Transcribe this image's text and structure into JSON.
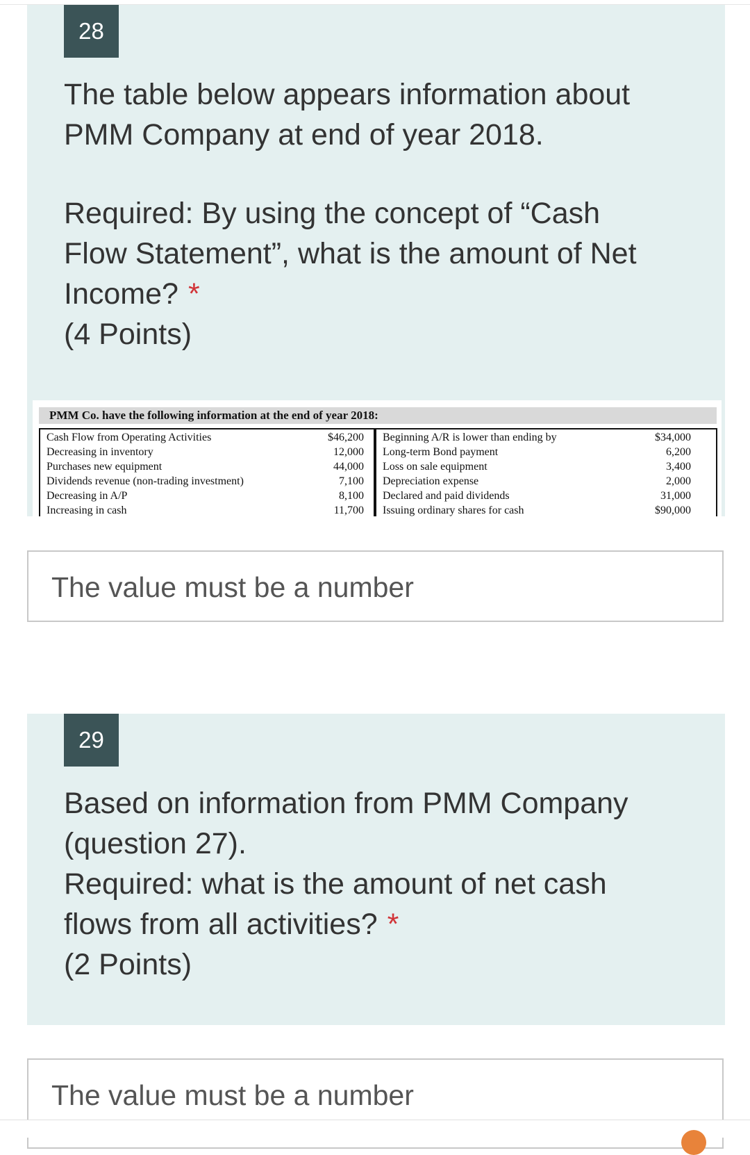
{
  "q28": {
    "number": "28",
    "title_lines": [
      "The table below appears information about",
      "PMM Company at end of year 2018.",
      "",
      "Required: By using the concept of “Cash",
      "Flow Statement”, what is the amount of Net",
      "Income?"
    ],
    "required_mark": "*",
    "points": "(4 Points)",
    "table": {
      "header": "PMM Co. have the following information at the end of year 2018:",
      "left": [
        {
          "label": "Cash Flow from Operating Activities",
          "value": "$46,200"
        },
        {
          "label": "Decreasing in inventory",
          "value": "12,000"
        },
        {
          "label": "Purchases new equipment",
          "value": "44,000"
        },
        {
          "label": "Dividends revenue (non-trading investment)",
          "value": "7,100"
        },
        {
          "label": "Decreasing in A/P",
          "value": "8,100"
        },
        {
          "label": "Increasing in cash",
          "value": "11,700"
        }
      ],
      "right": [
        {
          "label": "Beginning A/R is lower than ending by",
          "value": "$34,000"
        },
        {
          "label": "Long-term Bond payment",
          "value": "6,200"
        },
        {
          "label": "Loss on sale equipment",
          "value": "3,400"
        },
        {
          "label": "Depreciation expense",
          "value": "2,000"
        },
        {
          "label": "Declared and paid dividends",
          "value": "31,000"
        },
        {
          "label": "Issuing ordinary shares for cash",
          "value": "$90,000"
        }
      ]
    },
    "answer_placeholder": "The value must be a number"
  },
  "q29": {
    "number": "29",
    "title_lines": [
      "Based on information from PMM Company",
      "(question 27).",
      "Required: what is the amount of net cash",
      "flows from all activities?"
    ],
    "required_mark": "*",
    "points": "(2 Points)",
    "answer_placeholder": "The value must be a number"
  },
  "colors": {
    "card_bg": "#e4f0f0",
    "number_badge": "#3b5457",
    "required": "#d13438"
  }
}
